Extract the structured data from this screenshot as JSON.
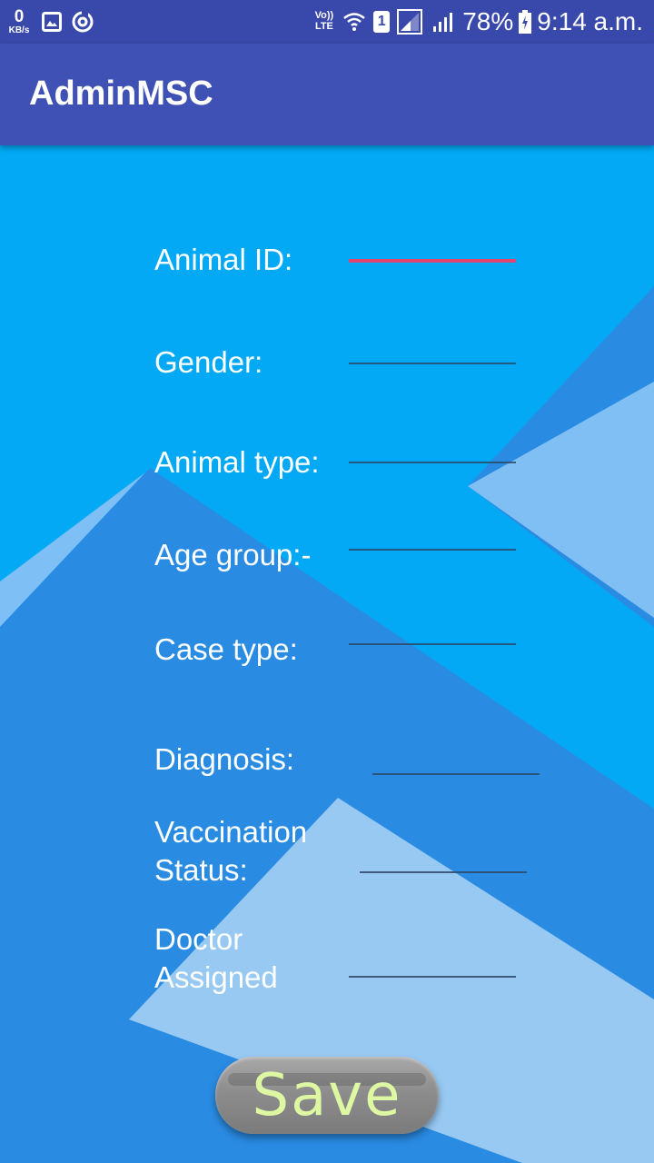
{
  "status_bar": {
    "speed_value": "0",
    "speed_unit": "KB/s",
    "volte_top": "Vo))",
    "volte_bottom": "LTE",
    "sim": "1",
    "battery": "78%",
    "time": "9:14 a.m."
  },
  "app_bar": {
    "title": "AdminMSC"
  },
  "form": {
    "animal_id_label": "Animal ID:",
    "gender_label": "Gender:",
    "animal_type_label": "Animal type:",
    "age_group_label": "Age group:-",
    "case_type_label": "Case type:",
    "diagnosis_label": "Diagnosis:",
    "vaccination_label": "Vaccination\nStatus:",
    "doctor_label": "Doctor\nAssigned",
    "save_label": "Save"
  },
  "colors": {
    "status_bar": "#3949ab",
    "app_bar": "#3f51b5",
    "background": "#03a9f4",
    "focus_underline": "#e1456f",
    "save_text": "#ddf7a2"
  }
}
